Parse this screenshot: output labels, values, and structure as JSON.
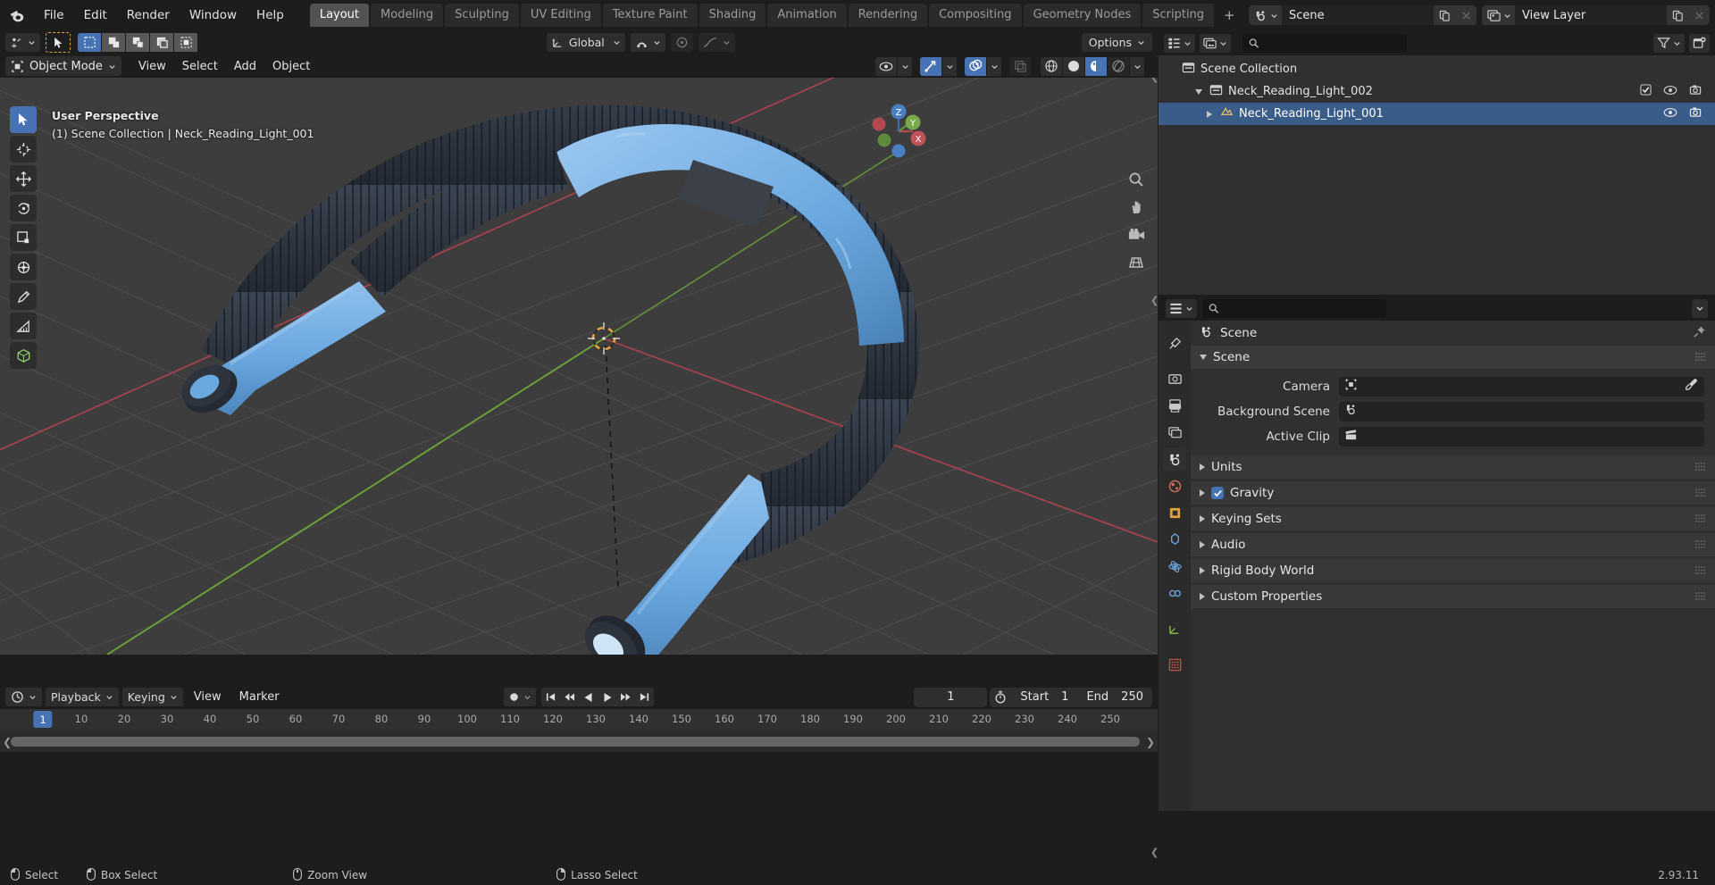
{
  "app": {
    "logo_icon": "blender-logo-icon",
    "version": "2.93.11"
  },
  "menu": {
    "items": [
      "File",
      "Edit",
      "Render",
      "Window",
      "Help"
    ]
  },
  "workspace_tabs": {
    "items": [
      "Layout",
      "Modeling",
      "Sculpting",
      "UV Editing",
      "Texture Paint",
      "Shading",
      "Animation",
      "Rendering",
      "Compositing",
      "Geometry Nodes",
      "Scripting"
    ],
    "active": "Layout",
    "add_label": "+"
  },
  "topbar_right": {
    "scene": {
      "icon": "scene-icon",
      "name": "Scene",
      "new_icon": "duplicate-icon",
      "unlink_icon": "x-icon"
    },
    "view_layer": {
      "icon": "view-layer-icon",
      "name": "View Layer",
      "new_icon": "duplicate-icon",
      "unlink_icon": "x-icon"
    }
  },
  "viewport": {
    "header_row1": {
      "editor_type_icon": "editor-type-icon",
      "cursor_tool_icon": "tweak-cursor-icon",
      "select_modes": [
        "set-select-icon",
        "extend-select-icon",
        "subtract-select-icon",
        "invert-select-icon",
        "intersect-select-icon"
      ],
      "transform_orientation": {
        "icon": "orientation-icon",
        "label": "Global"
      },
      "snap_icon": "magnet-icon",
      "proportional_icon": "proportional-edit-icon",
      "falloff_icon": "falloff-curve-icon",
      "options_label": "Options"
    },
    "header_row2": {
      "mode": {
        "icon": "object-mode-icon",
        "label": "Object Mode"
      },
      "menus": [
        "View",
        "Select",
        "Add",
        "Object"
      ],
      "visibility_icon": "eye-icon",
      "gizmo_icon": "gizmo-icon",
      "overlays_icon": "overlays-icon",
      "xray_icon": "xray-icon",
      "shading_modes": [
        "wireframe-icon",
        "solid-icon",
        "material-preview-icon",
        "rendered-icon"
      ],
      "shading_active": "material-preview-icon"
    },
    "overlay": {
      "perspective": "User Perspective",
      "collection_info": "(1) Scene Collection | Neck_Reading_Light_001"
    },
    "toolbar_tools": [
      "tweak-tool-icon",
      "cursor-tool-icon",
      "move-tool-icon",
      "rotate-tool-icon",
      "scale-tool-icon",
      "transform-tool-icon",
      "annotate-tool-icon",
      "measure-tool-icon",
      "add-cube-tool-icon"
    ],
    "toolbar_active_index": 0,
    "nav_gizmo": {
      "axes": [
        "X",
        "Y",
        "Z"
      ],
      "label_z": "Z",
      "label_y": "Y",
      "label_x": "X"
    },
    "right_icons": [
      "zoom-icon",
      "move-view-icon",
      "camera-view-icon",
      "ortho-persp-icon"
    ],
    "scene_objects": [
      "Neck_Reading_Light_001"
    ],
    "colors": {
      "object_blue": "#6aa9e0",
      "object_dark": "#2f3640",
      "grid": "#4a4a4a",
      "x_axis": "#a33d4a",
      "y_axis": "#69a13a",
      "background": "#3d3d3d"
    }
  },
  "outliner": {
    "display_mode_icon": "outliner-icon",
    "filter_id_icon": "filter-id-icon",
    "search_placeholder": "",
    "search_value": "",
    "filter_icon": "funnel-icon",
    "new_collection_icon": "new-collection-icon",
    "rows": [
      {
        "label": "Scene Collection",
        "icon": "collection-icon",
        "indent": 0,
        "expandable": false,
        "selected": false,
        "icons": []
      },
      {
        "label": "Neck_Reading_Light_002",
        "icon": "collection-icon",
        "indent": 1,
        "expandable": true,
        "selected": false,
        "icons": [
          "checkbox-icon",
          "eye-icon",
          "camera-icon"
        ]
      },
      {
        "label": "Neck_Reading_Light_001",
        "icon": "mesh-data-icon",
        "indent": 2,
        "expandable": true,
        "selected": true,
        "icons": [
          "eye-icon",
          "camera-icon"
        ]
      }
    ]
  },
  "properties": {
    "search_placeholder": "",
    "search_value": "",
    "editor_icon": "properties-editor-icon",
    "tabs": [
      "tool-tab-icon",
      "render-tab-icon",
      "output-tab-icon",
      "view-layer-tab-icon",
      "scene-tab-icon",
      "world-tab-icon",
      "object-tab-icon",
      "modifier-tab-icon",
      "physics-tab-icon",
      "constraint-tab-icon",
      "data-tab-icon",
      "material-tab-icon"
    ],
    "active_tab_index": 4,
    "breadcrumb": {
      "icon": "scene-icon",
      "label": "Scene",
      "pin_icon": "pin-icon"
    },
    "panels": [
      {
        "label": "Scene",
        "open": true
      },
      {
        "label": "Units",
        "open": false
      },
      {
        "label": "Gravity",
        "open": false,
        "checkbox": true
      },
      {
        "label": "Keying Sets",
        "open": false
      },
      {
        "label": "Audio",
        "open": false
      },
      {
        "label": "Rigid Body World",
        "open": false
      },
      {
        "label": "Custom Properties",
        "open": false
      }
    ],
    "scene_fields": [
      {
        "label": "Camera",
        "icon": "camera-data-icon",
        "value": "",
        "eyedropper": true
      },
      {
        "label": "Background Scene",
        "icon": "scene-icon",
        "value": "",
        "eyedropper": false
      },
      {
        "label": "Active Clip",
        "icon": "clip-icon",
        "value": "",
        "eyedropper": false
      }
    ]
  },
  "timeline": {
    "editor_icon": "timeline-editor-icon",
    "dropdowns": [
      "Playback",
      "Keying"
    ],
    "menus": [
      "View",
      "Marker"
    ],
    "record_icon": "record-icon",
    "transport": [
      "jump-start-icon",
      "prev-keyframe-icon",
      "play-reverse-icon",
      "play-icon",
      "next-keyframe-icon",
      "jump-end-icon"
    ],
    "current_frame": "1",
    "frame_range_icon": "stopwatch-icon",
    "start_label": "Start",
    "start_value": "1",
    "end_label": "End",
    "end_value": "250",
    "ruler_ticks": [
      "10",
      "20",
      "30",
      "40",
      "50",
      "60",
      "70",
      "80",
      "90",
      "100",
      "110",
      "120",
      "130",
      "140",
      "150",
      "160",
      "170",
      "180",
      "190",
      "200",
      "210",
      "220",
      "230",
      "240",
      "250"
    ],
    "playhead_frame": "1"
  },
  "statusbar": {
    "hints": [
      {
        "icon": "mouse-left-icon",
        "label": "Select"
      },
      {
        "icon": "mouse-left-drag-icon",
        "label": "Box Select"
      },
      {
        "icon": "mouse-middle-icon",
        "label": "Zoom View"
      },
      {
        "icon": "mouse-right-icon",
        "label": "Lasso Select"
      }
    ],
    "version": "2.93.11"
  }
}
